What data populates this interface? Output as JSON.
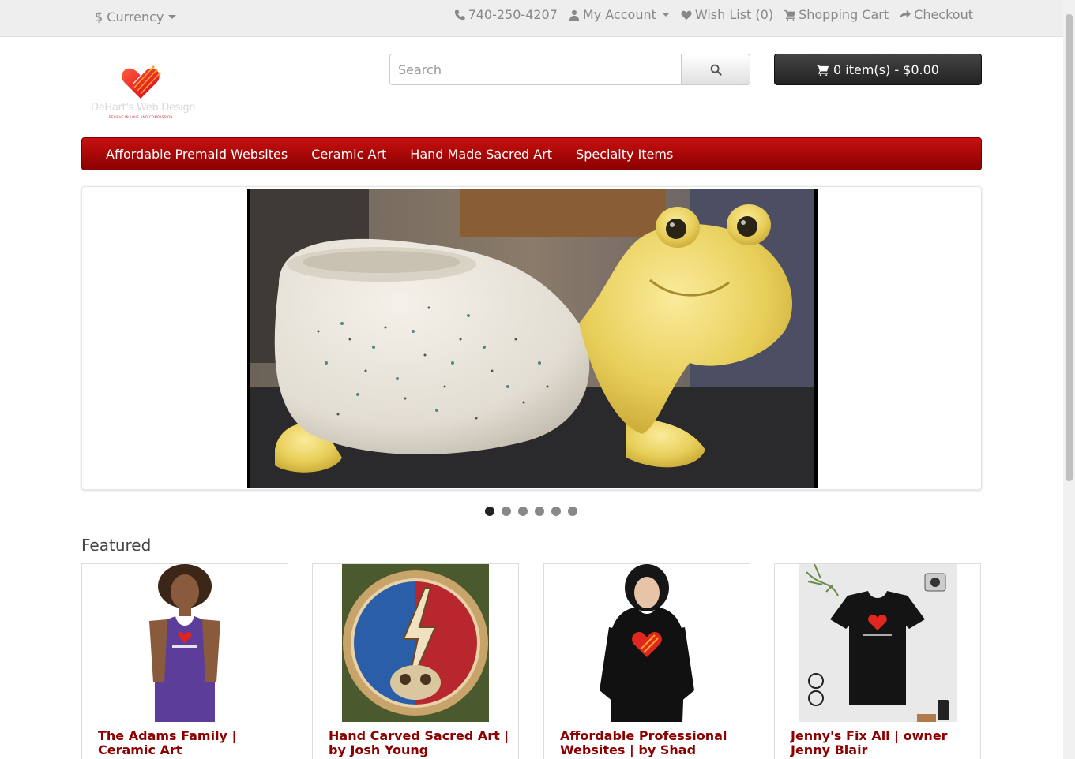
{
  "topbar": {
    "currency_label": "$ Currency",
    "phone": "740-250-4207",
    "my_account": "My Account",
    "wish_list": "Wish List (0)",
    "shopping_cart": "Shopping Cart",
    "checkout": "Checkout"
  },
  "header": {
    "logo_text": "DeHart's Web Design",
    "logo_tagline": "BELIEVE IN LOVE AND COMPASSION",
    "search_placeholder": "Search",
    "cart_button": "0 item(s) - $0.00"
  },
  "menu": {
    "items": [
      "Affordable Premaid Websites",
      "Ceramic Art",
      "Hand Made Sacred Art",
      "Specialty Items"
    ]
  },
  "slideshow": {
    "slide_count": 6,
    "active_index": 0
  },
  "featured": {
    "heading": "Featured",
    "products": [
      {
        "title": "The Adams Family | Ceramic Art"
      },
      {
        "title": "Hand Carved Sacred Art | by Josh Young"
      },
      {
        "title": "Affordable Professional Websites | by Shad DeHart"
      },
      {
        "title": "Jenny's Fix All | owner Jenny Blair"
      }
    ]
  },
  "colors": {
    "brand_red": "#8b0000",
    "menu_red": "#c81010",
    "topbar_bg": "#eeeeee"
  }
}
